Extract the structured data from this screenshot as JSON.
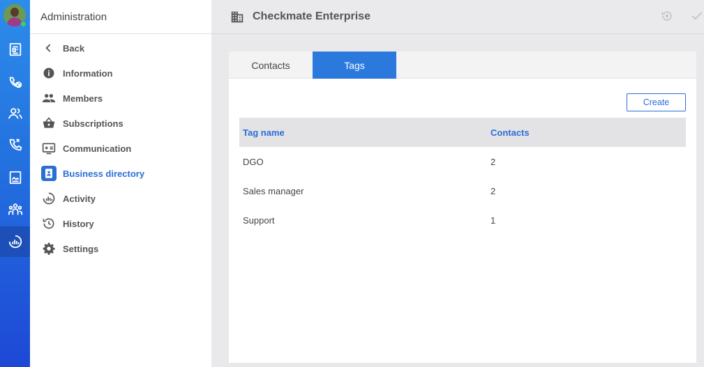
{
  "rail": {
    "items": [
      {
        "icon": "news-icon"
      },
      {
        "icon": "phone-clock-icon"
      },
      {
        "icon": "contacts-icon"
      },
      {
        "icon": "call-icon"
      },
      {
        "icon": "picture-card-icon"
      },
      {
        "icon": "team-icon"
      },
      {
        "icon": "activity-dashboard-icon",
        "active": true
      }
    ]
  },
  "sidebar": {
    "title": "Administration",
    "items": [
      {
        "label": "Back",
        "icon": "chevron-left-icon"
      },
      {
        "label": "Information",
        "icon": "info-icon"
      },
      {
        "label": "Members",
        "icon": "members-icon"
      },
      {
        "label": "Subscriptions",
        "icon": "basket-icon"
      },
      {
        "label": "Communication",
        "icon": "monitor-star-icon"
      },
      {
        "label": "Business directory",
        "icon": "directory-icon",
        "active": true
      },
      {
        "label": "Activity",
        "icon": "activity-icon"
      },
      {
        "label": "History",
        "icon": "history-icon"
      },
      {
        "label": "Settings",
        "icon": "gear-icon"
      }
    ]
  },
  "header": {
    "title": "Checkmate Enterprise"
  },
  "tabs": [
    {
      "label": "Contacts"
    },
    {
      "label": "Tags",
      "active": true
    }
  ],
  "actions": {
    "create_label": "Create"
  },
  "table": {
    "columns": [
      "Tag name",
      "Contacts"
    ],
    "rows": [
      {
        "name": "DGO",
        "contacts": "2"
      },
      {
        "name": "Sales manager",
        "contacts": "2"
      },
      {
        "name": "Support",
        "contacts": "1"
      }
    ]
  },
  "colors": {
    "accent": "#2a6fd6",
    "rail_top": "#2d8de9",
    "rail_bottom": "#1d48d6",
    "presence": "#3fd15a"
  }
}
